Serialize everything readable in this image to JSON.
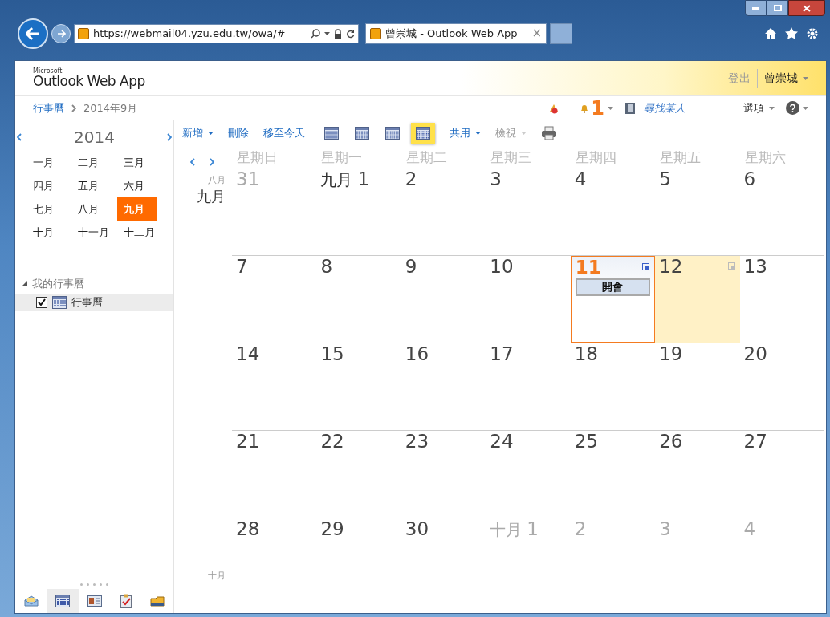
{
  "browser": {
    "address": "https://webmail04.yzu.edu.tw/owa/#",
    "tabs": [
      {
        "title": "曾崇城 - Outlook Web App",
        "selected": true,
        "close": "×"
      }
    ]
  },
  "header": {
    "brand_small": "Microsoft",
    "brand": "Outlook Web App",
    "sign_out": "登出",
    "user": "曾崇城"
  },
  "breadcrumb": {
    "items": [
      "行事曆",
      "2014年9月"
    ],
    "reminders": "1",
    "find_people": {
      "placeholder": "尋找某人"
    },
    "options": "選項"
  },
  "mini_calendar": {
    "year": "2014",
    "months": [
      {
        "label": "一月",
        "selected": false
      },
      {
        "label": "二月",
        "selected": false
      },
      {
        "label": "三月",
        "selected": false
      },
      {
        "label": "四月",
        "selected": false
      },
      {
        "label": "五月",
        "selected": false
      },
      {
        "label": "六月",
        "selected": false
      },
      {
        "label": "七月",
        "selected": false
      },
      {
        "label": "八月",
        "selected": false
      },
      {
        "label": "九月",
        "selected": true
      },
      {
        "label": "十月",
        "selected": false
      },
      {
        "label": "十一月",
        "selected": false
      },
      {
        "label": "十二月",
        "selected": false
      }
    ]
  },
  "calendars": {
    "group": "我的行事曆",
    "expanded": true,
    "items": [
      {
        "label": "行事曆",
        "checked": true,
        "selected": true
      }
    ]
  },
  "nav": [
    {
      "kind": "mail",
      "selected": false
    },
    {
      "kind": "calendar",
      "selected": true
    },
    {
      "kind": "contacts",
      "selected": false
    },
    {
      "kind": "tasks",
      "selected": false
    },
    {
      "kind": "folders",
      "selected": false
    }
  ],
  "toolbar": {
    "new": "新增",
    "delete": "刪除",
    "today": "移至今天",
    "views": [
      {
        "kind": "day",
        "selected": false
      },
      {
        "kind": "workweek",
        "selected": false
      },
      {
        "kind": "week",
        "selected": false
      },
      {
        "kind": "month",
        "selected": true
      }
    ],
    "share": "共用",
    "view": {
      "label": "檢視",
      "disabled": true
    }
  },
  "calendar": {
    "weekdays": [
      "星期日",
      "星期一",
      "星期二",
      "星期三",
      "星期四",
      "星期五",
      "星期六"
    ],
    "weeks": [
      {
        "gutter": [
          {
            "text": "八月",
            "kind": "prev"
          },
          {
            "text": "九月",
            "kind": "current"
          }
        ],
        "days": [
          {
            "day": "31",
            "muted": true,
            "today": false,
            "selected": false
          },
          {
            "month": "九月",
            "day": "1",
            "muted": false,
            "today": false,
            "selected": false
          },
          {
            "day": "2",
            "muted": false,
            "today": false,
            "selected": false
          },
          {
            "day": "3",
            "muted": false,
            "today": false,
            "selected": false
          },
          {
            "day": "4",
            "muted": false,
            "today": false,
            "selected": false
          },
          {
            "day": "5",
            "muted": false,
            "today": false,
            "selected": false
          },
          {
            "day": "6",
            "muted": false,
            "today": false,
            "selected": false
          }
        ]
      },
      {
        "days": [
          {
            "day": "7",
            "muted": false,
            "today": false,
            "selected": false
          },
          {
            "day": "8",
            "muted": false,
            "today": false,
            "selected": false
          },
          {
            "day": "9",
            "muted": false,
            "today": false,
            "selected": false
          },
          {
            "day": "10",
            "muted": false,
            "today": false,
            "selected": false
          },
          {
            "day": "11",
            "muted": false,
            "today": true,
            "selected": false,
            "events": [
              "開會"
            ]
          },
          {
            "day": "12",
            "muted": false,
            "today": false,
            "selected": true
          },
          {
            "day": "13",
            "muted": false,
            "today": false,
            "selected": false
          }
        ]
      },
      {
        "days": [
          {
            "day": "14",
            "muted": false,
            "today": false,
            "selected": false
          },
          {
            "day": "15",
            "muted": false,
            "today": false,
            "selected": false
          },
          {
            "day": "16",
            "muted": false,
            "today": false,
            "selected": false
          },
          {
            "day": "17",
            "muted": false,
            "today": false,
            "selected": false
          },
          {
            "day": "18",
            "muted": false,
            "today": false,
            "selected": false
          },
          {
            "day": "19",
            "muted": false,
            "today": false,
            "selected": false
          },
          {
            "day": "20",
            "muted": false,
            "today": false,
            "selected": false
          }
        ]
      },
      {
        "days": [
          {
            "day": "21",
            "muted": false,
            "today": false,
            "selected": false
          },
          {
            "day": "22",
            "muted": false,
            "today": false,
            "selected": false
          },
          {
            "day": "23",
            "muted": false,
            "today": false,
            "selected": false
          },
          {
            "day": "24",
            "muted": false,
            "today": false,
            "selected": false
          },
          {
            "day": "25",
            "muted": false,
            "today": false,
            "selected": false
          },
          {
            "day": "26",
            "muted": false,
            "today": false,
            "selected": false
          },
          {
            "day": "27",
            "muted": false,
            "today": false,
            "selected": false
          }
        ]
      },
      {
        "gutter": [
          {
            "text": "十月",
            "kind": "next"
          }
        ],
        "days": [
          {
            "day": "28",
            "muted": false,
            "today": false,
            "selected": false
          },
          {
            "day": "29",
            "muted": false,
            "today": false,
            "selected": false
          },
          {
            "day": "30",
            "muted": false,
            "today": false,
            "selected": false
          },
          {
            "month": "十月",
            "day": "1",
            "muted": true,
            "today": false,
            "selected": false
          },
          {
            "day": "2",
            "muted": true,
            "today": false,
            "selected": false
          },
          {
            "day": "3",
            "muted": true,
            "today": false,
            "selected": false
          },
          {
            "day": "4",
            "muted": true,
            "today": false,
            "selected": false
          }
        ]
      }
    ]
  }
}
